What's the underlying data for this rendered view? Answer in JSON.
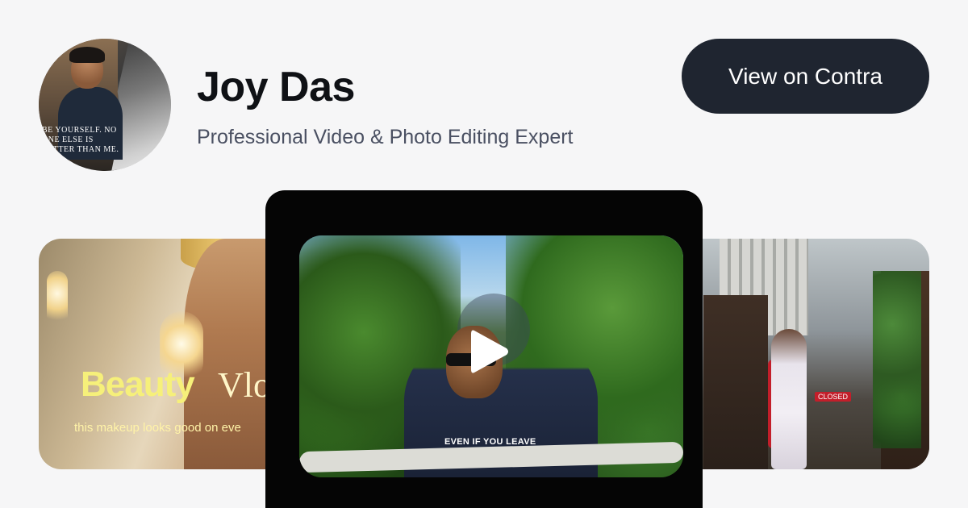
{
  "profile": {
    "name": "Joy Das",
    "tagline": "Professional Video & Photo Editing Expert",
    "avatar_quote": "BE YOURSELF. NO ONE ELSE IS BETTER THAN ME."
  },
  "cta": {
    "label": "View on Contra"
  },
  "gallery": {
    "left_thumb": {
      "title_bold": "Beauty",
      "title_serif": "Vlo",
      "subtitle": "this makeup looks good on eve"
    },
    "video": {
      "caption": "EVEN IF YOU LEAVE"
    },
    "right_thumb": {
      "sign": "CLOSED"
    }
  },
  "colors": {
    "background": "#f6f6f7",
    "cta_bg": "#1f2530",
    "name_text": "#0f1115",
    "tagline_text": "#4a5062",
    "video_card_bg": "#050505"
  },
  "icons": {
    "play": "play-icon"
  }
}
